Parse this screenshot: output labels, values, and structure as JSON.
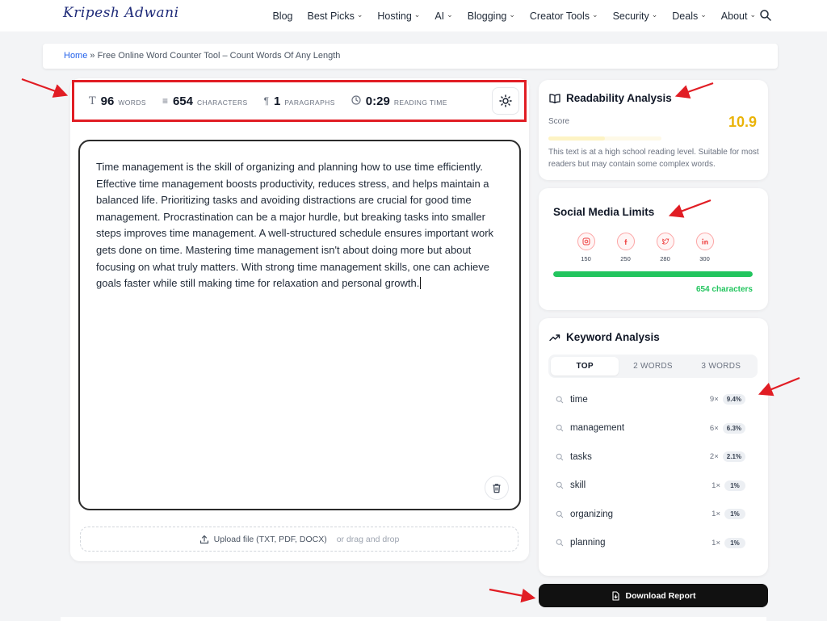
{
  "header": {
    "logo": "Kripesh Adwani",
    "nav": [
      {
        "label": "Blog",
        "has_menu": false
      },
      {
        "label": "Best Picks",
        "has_menu": true
      },
      {
        "label": "Hosting",
        "has_menu": true
      },
      {
        "label": "AI",
        "has_menu": true
      },
      {
        "label": "Blogging",
        "has_menu": true
      },
      {
        "label": "Creator Tools",
        "has_menu": true
      },
      {
        "label": "Security",
        "has_menu": true
      },
      {
        "label": "Deals",
        "has_menu": true
      },
      {
        "label": "About",
        "has_menu": true
      }
    ],
    "search_icon": "search-icon"
  },
  "breadcrumb": {
    "home": "Home",
    "separator": "»",
    "current": "Free Online Word Counter Tool – Count Words Of Any Length"
  },
  "stats": {
    "words": {
      "value": "96",
      "label": "WORDS",
      "icon": "text-icon"
    },
    "characters": {
      "value": "654",
      "label": "CHARACTERS",
      "icon": "lines-icon"
    },
    "paragraphs": {
      "value": "1",
      "label": "PARAGRAPHS",
      "icon": "pilcrow-icon"
    },
    "reading_time": {
      "value": "0:29",
      "label": "READING TIME",
      "icon": "clock-icon"
    },
    "theme_toggle_icon": "sun-icon"
  },
  "editor": {
    "text": "Time management is the skill of organizing and planning how to use time efficiently. Effective time management boosts productivity, reduces stress, and helps maintain a balanced life. Prioritizing tasks and avoiding distractions are crucial for good time management. Procrastination can be a major hurdle, but breaking tasks into smaller steps improves time management. A well-structured schedule ensures important work gets done on time. Mastering time management isn't about doing more but about focusing on what truly matters. With strong time management skills, one can achieve goals faster while still making time for relaxation and personal growth.",
    "clear_icon": "trash-icon"
  },
  "upload": {
    "label": "Upload file (TXT, PDF, DOCX)",
    "hint": "or drag and drop",
    "icon": "upload-icon"
  },
  "readability": {
    "title": "Readability Analysis",
    "icon": "book-icon",
    "score_label": "Score",
    "score": "10.9",
    "score_fraction": 0.5,
    "score_color": "#eab308",
    "description": "This text is at a high school reading level. Suitable for most readers but may contain some complex words."
  },
  "social": {
    "title": "Social Media Limits",
    "platforms": [
      {
        "name": "instagram-icon",
        "limit": "150"
      },
      {
        "name": "facebook-icon",
        "limit": "250"
      },
      {
        "name": "twitter-icon",
        "limit": "280"
      },
      {
        "name": "linkedin-icon",
        "limit": "300"
      }
    ],
    "progress_fraction": 1.0,
    "progress_color": "#22c55e",
    "count_text": "654 characters"
  },
  "keywords": {
    "title": "Keyword Analysis",
    "icon": "trending-up-icon",
    "tabs": [
      "TOP",
      "2 WORDS",
      "3 WORDS"
    ],
    "active_tab": "TOP",
    "rows": [
      {
        "word": "time",
        "count": "9×",
        "percent": "9.4%"
      },
      {
        "word": "management",
        "count": "6×",
        "percent": "6.3%"
      },
      {
        "word": "tasks",
        "count": "2×",
        "percent": "2.1%"
      },
      {
        "word": "skill",
        "count": "1×",
        "percent": "1%"
      },
      {
        "word": "organizing",
        "count": "1×",
        "percent": "1%"
      },
      {
        "word": "planning",
        "count": "1×",
        "percent": "1%"
      }
    ]
  },
  "download": {
    "label": "Download Report",
    "icon": "file-download-icon"
  },
  "annotation_color": "#e11d24"
}
